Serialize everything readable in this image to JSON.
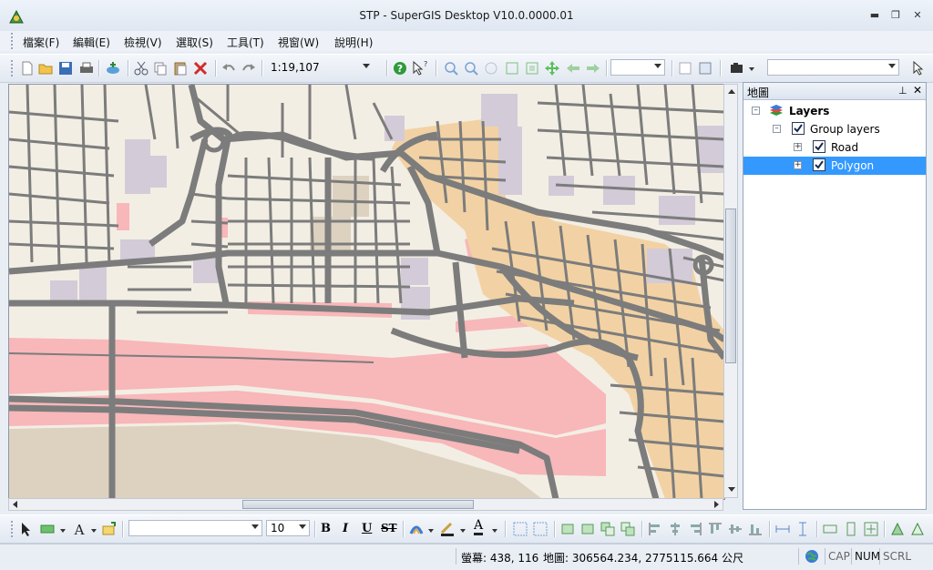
{
  "window": {
    "title": "STP - SuperGIS Desktop V10.0.0000.01"
  },
  "menu": [
    {
      "label": "檔案(F)"
    },
    {
      "label": "編輯(E)"
    },
    {
      "label": "檢視(V)"
    },
    {
      "label": "選取(S)"
    },
    {
      "label": "工具(T)"
    },
    {
      "label": "視窗(W)"
    },
    {
      "label": "說明(H)"
    }
  ],
  "toolbar": {
    "scale_value": "1:19,107",
    "zoom_combo_value": "",
    "layer_combo_value": ""
  },
  "format_toolbar": {
    "font_combo_value": "",
    "font_size_value": "10",
    "bold_label": "B",
    "italic_label": "I",
    "underline_label": "U",
    "strike_label": "ST",
    "font_color_label": "A"
  },
  "panel": {
    "title": "地圖",
    "tree": [
      {
        "label": "Layers",
        "level": 0,
        "checked": null,
        "selected": false
      },
      {
        "label": "Group layers",
        "level": 1,
        "checked": true,
        "selected": false
      },
      {
        "label": "Road",
        "level": 2,
        "checked": true,
        "selected": false
      },
      {
        "label": "Polygon",
        "level": 2,
        "checked": true,
        "selected": true
      }
    ]
  },
  "status": {
    "screen_coords": "螢幕: 438, 116",
    "map_coords": "地圖: 306564.234, 2775115.664 公尺",
    "cap": "CAP",
    "num": "NUM",
    "scrl": "SCRL"
  },
  "colors": {
    "selection": "#3399ff",
    "map_background": "#f3eee4",
    "road": "#7c7c7c",
    "urban_orange": "#f2d2a4",
    "pink_zone": "#f8b7b9",
    "building_lilac": "#d3cbd8",
    "tan_zone": "#ddd2c0"
  }
}
